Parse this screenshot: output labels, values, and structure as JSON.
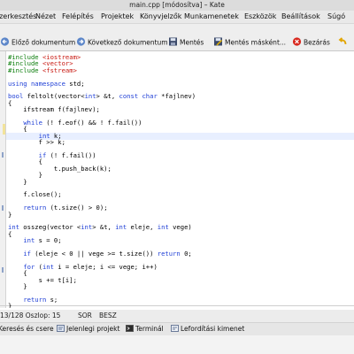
{
  "window": {
    "title": "main.cpp [módosítva] – Kate"
  },
  "menubar": {
    "items": [
      {
        "label": "Szerkesztés"
      },
      {
        "label": "Nézet"
      },
      {
        "label": "Felépítés"
      },
      {
        "label": "Projektek"
      },
      {
        "label": "Könyvjelzők"
      },
      {
        "label": "Munkamenetek"
      },
      {
        "label": "Eszközök"
      },
      {
        "label": "Beállítások"
      },
      {
        "label": "Súgó"
      }
    ]
  },
  "toolbar": {
    "prev_doc": "Előző dokumentum",
    "next_doc": "Következő dokumentum",
    "save": "Mentés",
    "save_as": "Mentés másként...",
    "close": "Bezárás"
  },
  "editor": {
    "lines": [
      "#include <iostream>",
      "#include <vector>",
      "#include <fstream>",
      "",
      "using namespace std;",
      "",
      "bool feltolt(vector<int> &t, const char *fajlnev)",
      "{",
      "    ifstream f(fajlnev);",
      "",
      "    while (! f.eof() && ! f.fail())",
      "    {",
      "        int k;",
      "        f >> k;",
      "",
      "        if (! f.fail())",
      "        {",
      "            t.push_back(k);",
      "        }",
      "    }",
      "",
      "    f.close();",
      "",
      "    return (t.size() > 0);",
      "}",
      "",
      "int osszeg(vector <int> &t, int eleje, int vege)",
      "{",
      "    int s = 0;",
      "",
      "    if (eleje < 0 || vege >= t.size()) return 0;",
      "",
      "    for (int i = eleje; i <= vege; i++)",
      "    {",
      "        s += t[i];",
      "    }",
      "",
      "    return s;",
      "}"
    ]
  },
  "statusbar": {
    "position": "13/128 Oszlop: 15",
    "mode": "SOR",
    "insert": "BESZ"
  },
  "bottom_tabs": {
    "search_replace": "Keresés és csere",
    "current_project": "Jelenlegi projekt",
    "terminal": "Terminál",
    "compiler_output": "Lefordítási kimenet"
  },
  "colors": {
    "keyword": "#1f3fd6",
    "preprocessor": "#0a7d0a",
    "string": "#c8170f",
    "current_line": "#e8efff"
  }
}
